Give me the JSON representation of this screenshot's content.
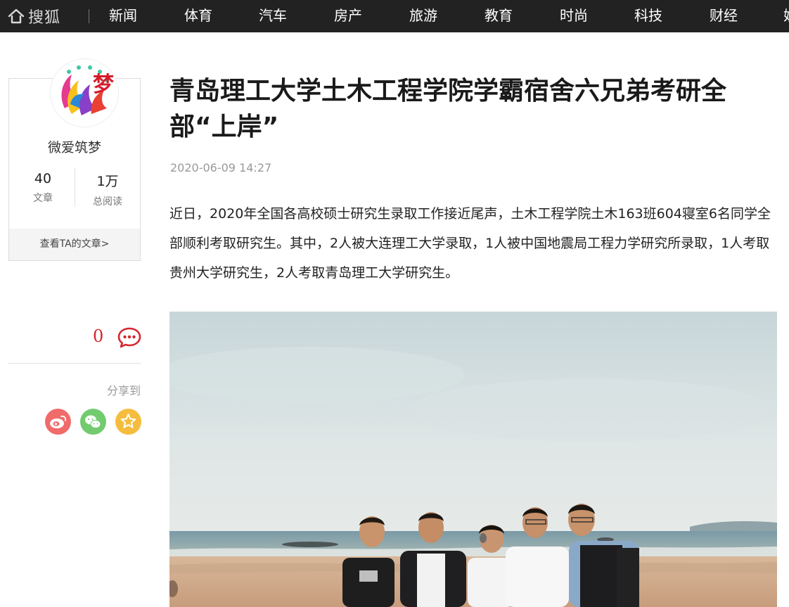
{
  "nav": {
    "logo_text": "搜狐",
    "items": [
      "新闻",
      "体育",
      "汽车",
      "房产",
      "旅游",
      "教育",
      "时尚",
      "科技",
      "财经",
      "娱"
    ]
  },
  "author": {
    "name": "微爱筑梦",
    "avatar_glyph": "梦",
    "stats": [
      {
        "value": "40",
        "label": "文章"
      },
      {
        "value": "1万",
        "label": "总阅读"
      }
    ],
    "view_link": "查看TA的文章>"
  },
  "comments": {
    "count": "0",
    "icon": "comment-bubble-icon"
  },
  "share": {
    "label": "分享到",
    "buttons": [
      {
        "name": "weibo",
        "icon": "weibo-icon",
        "color": "#f16b6b"
      },
      {
        "name": "wechat",
        "icon": "wechat-icon",
        "color": "#72cb6f"
      },
      {
        "name": "favorite",
        "icon": "star-icon",
        "color": "#f5bd3d"
      }
    ]
  },
  "article": {
    "title": "青岛理工大学土木工程学院学霸宿舍六兄弟考研全部“上岸”",
    "time": "2020-06-09 14:27",
    "paragraph": "近日，2020年全国各高校硕士研究生录取工作接近尾声，土木工程学院土木163班604寝室6名同学全部顺利考取研究生。其中，2人被大连理工大学录取，1人被中国地震局工程力学研究所录取，1人考取贵州大学研究生，2人考取青岛理工大学研究生。"
  },
  "colors": {
    "nav_bg": "#222222",
    "accent_red": "#d6262d",
    "text_main": "#222222",
    "text_muted": "#999999"
  }
}
